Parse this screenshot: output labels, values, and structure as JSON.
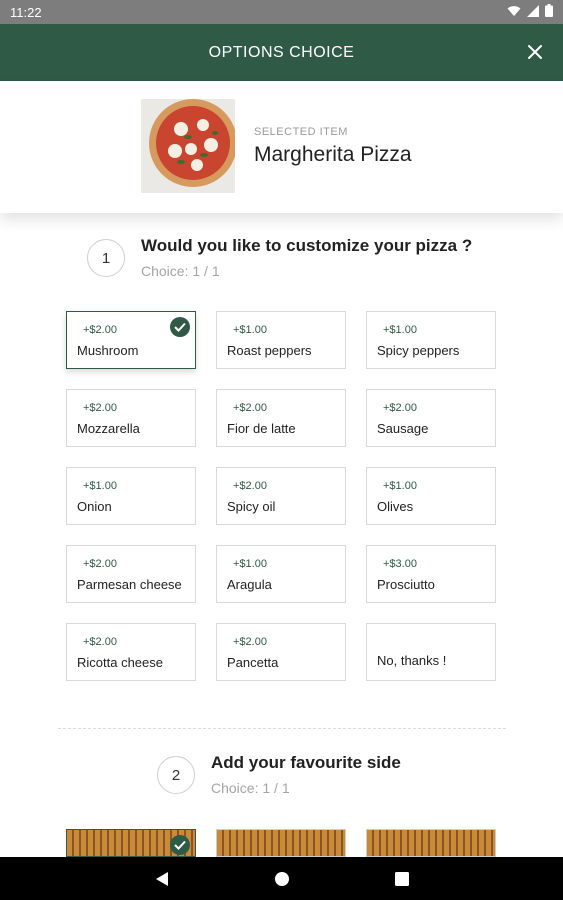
{
  "status_bar": {
    "time": "11:22"
  },
  "header": {
    "title": "OPTIONS CHOICE"
  },
  "selected_item": {
    "label": "SELECTED ITEM",
    "name": "Margherita Pizza"
  },
  "sections": [
    {
      "number": "1",
      "title": "Would you like to customize your pizza ?",
      "choice": "Choice: 1 / 1"
    },
    {
      "number": "2",
      "title": "Add your favourite side",
      "choice": "Choice: 1 / 1"
    }
  ],
  "options": [
    {
      "price": "+$2.00",
      "name": "Mushroom",
      "selected": true
    },
    {
      "price": "+$1.00",
      "name": "Roast peppers",
      "selected": false
    },
    {
      "price": "+$1.00",
      "name": "Spicy peppers",
      "selected": false
    },
    {
      "price": "+$2.00",
      "name": "Mozzarella",
      "selected": false
    },
    {
      "price": "+$2.00",
      "name": "Fior de latte",
      "selected": false
    },
    {
      "price": "+$2.00",
      "name": "Sausage",
      "selected": false
    },
    {
      "price": "+$1.00",
      "name": "Onion",
      "selected": false
    },
    {
      "price": "+$2.00",
      "name": "Spicy oil",
      "selected": false
    },
    {
      "price": "+$1.00",
      "name": "Olives",
      "selected": false
    },
    {
      "price": "+$2.00",
      "name": "Parmesan cheese",
      "selected": false
    },
    {
      "price": "+$1.00",
      "name": "Aragula",
      "selected": false
    },
    {
      "price": "+$3.00",
      "name": "Prosciutto",
      "selected": false
    },
    {
      "price": "+$2.00",
      "name": "Ricotta cheese",
      "selected": false
    },
    {
      "price": "+$2.00",
      "name": "Pancetta",
      "selected": false
    },
    {
      "price": "",
      "name": "No, thanks !",
      "selected": false
    }
  ],
  "sides": [
    {
      "selected": true
    },
    {
      "selected": false
    },
    {
      "selected": false
    }
  ],
  "colors": {
    "accent": "#2f5a46",
    "price_text": "#2f5a46",
    "muted_text": "#a5a5a5"
  },
  "icons": {
    "close": "close-icon",
    "check": "check-icon",
    "wifi": "wifi-icon",
    "signal": "signal-icon",
    "battery": "battery-icon",
    "back": "back-icon",
    "home": "home-icon",
    "recents": "recents-icon"
  }
}
